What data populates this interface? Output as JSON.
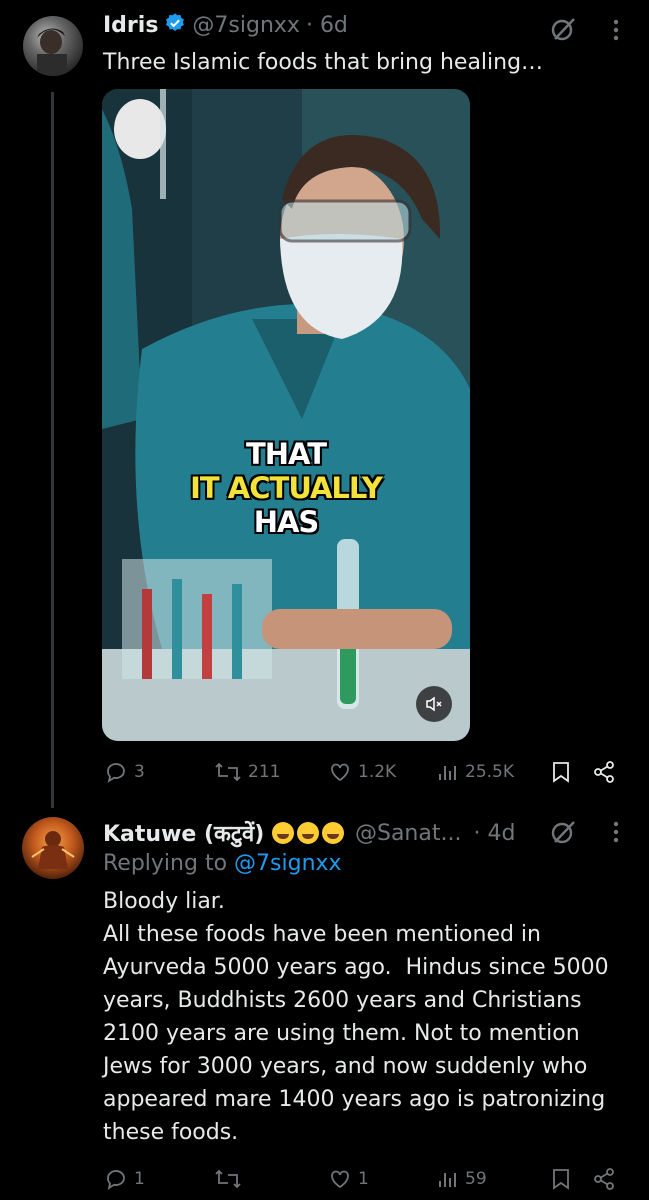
{
  "tweet1": {
    "display_name": "Idris",
    "handle": "@7signxx",
    "time": "· 6d",
    "text": "Three Islamic foods that bring healing…",
    "video": {
      "caption_line1": "THAT",
      "caption_line2": "IT ACTUALLY",
      "caption_line3": "HAS"
    },
    "actions": {
      "replies": "3",
      "reposts": "211",
      "likes": "1.2K",
      "views": "25.5K"
    }
  },
  "tweet2": {
    "display_name": "Katuwe (कटुवें)",
    "handle": "@Sanat...",
    "time": "· 4d",
    "replying_prefix": "Replying to",
    "replying_to": "@7signxx",
    "text_lines": [
      "Bloody liar.",
      "All these foods have been mentioned in",
      "Ayurveda 5000 years ago.  Hindus since 5000",
      "years, Buddhists 2600 years and Christians",
      "2100 years are using them. Not to mention",
      "Jews for 3000 years, and now suddenly who",
      "appeared mare 1400 years ago is patronizing",
      "these foods."
    ],
    "actions": {
      "replies": "1",
      "reposts": "",
      "likes": "1",
      "views": "59"
    }
  },
  "colors": {
    "background": "#000000",
    "text": "#e7e9ea",
    "muted": "#71767b",
    "accent": "#1d9bf0",
    "verified": "#1d9bf0",
    "caption_yellow": "#f2e23a"
  },
  "icons": [
    "grok-icon",
    "more-icon",
    "verified-icon",
    "reply-icon",
    "repost-icon",
    "like-icon",
    "views-icon",
    "bookmark-icon",
    "share-icon",
    "mute-icon"
  ]
}
